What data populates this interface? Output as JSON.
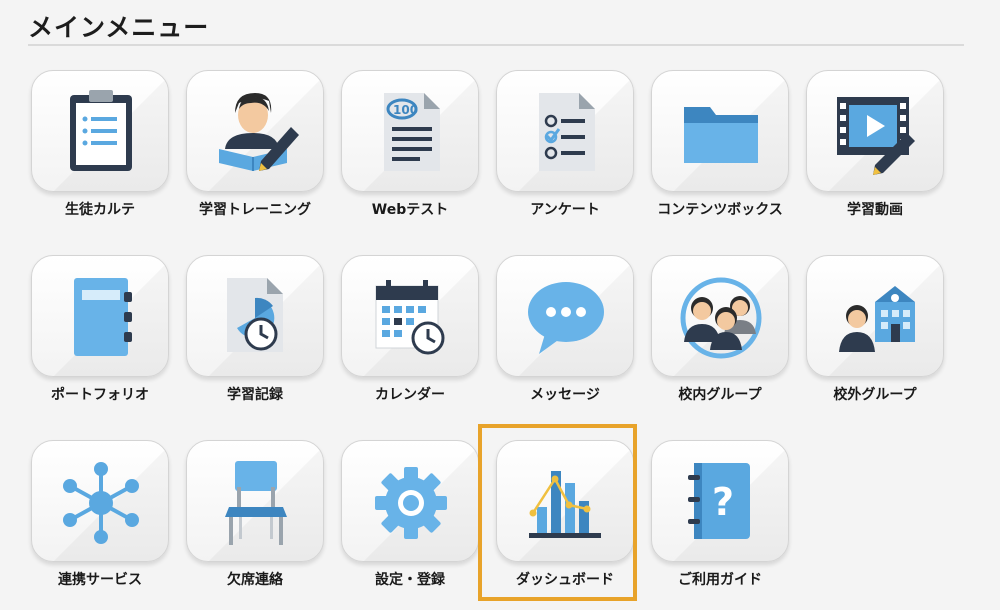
{
  "header": {
    "title": "メインメニュー"
  },
  "menu": {
    "items": [
      {
        "label": "生徒カルテ",
        "icon": "clipboard-icon"
      },
      {
        "label": "学習トレーニング",
        "icon": "student-pencil-icon"
      },
      {
        "label": "Webテスト",
        "icon": "test-paper-icon"
      },
      {
        "label": "アンケート",
        "icon": "survey-checklist-icon"
      },
      {
        "label": "コンテンツボックス",
        "icon": "folder-icon"
      },
      {
        "label": "学習動画",
        "icon": "video-film-icon"
      },
      {
        "label": "ポートフォリオ",
        "icon": "binder-notebook-icon"
      },
      {
        "label": "学習記録",
        "icon": "study-record-clock-icon"
      },
      {
        "label": "カレンダー",
        "icon": "calendar-clock-icon"
      },
      {
        "label": "メッセージ",
        "icon": "speech-bubble-icon"
      },
      {
        "label": "校内グループ",
        "icon": "group-people-icon"
      },
      {
        "label": "校外グループ",
        "icon": "outside-group-school-icon"
      },
      {
        "label": "連携サービス",
        "icon": "network-hub-icon"
      },
      {
        "label": "欠席連絡",
        "icon": "chair-icon"
      },
      {
        "label": "設定・登録",
        "icon": "gear-icon"
      },
      {
        "label": "ダッシュボード",
        "icon": "bar-chart-icon"
      },
      {
        "label": "ご利用ガイド",
        "icon": "guide-book-question-icon"
      }
    ],
    "selected": "ダッシュボード"
  },
  "colors": {
    "accent_blue": "#5aa8e0",
    "dark_navy": "#2e3b4e",
    "highlight": "#e8a32a"
  }
}
